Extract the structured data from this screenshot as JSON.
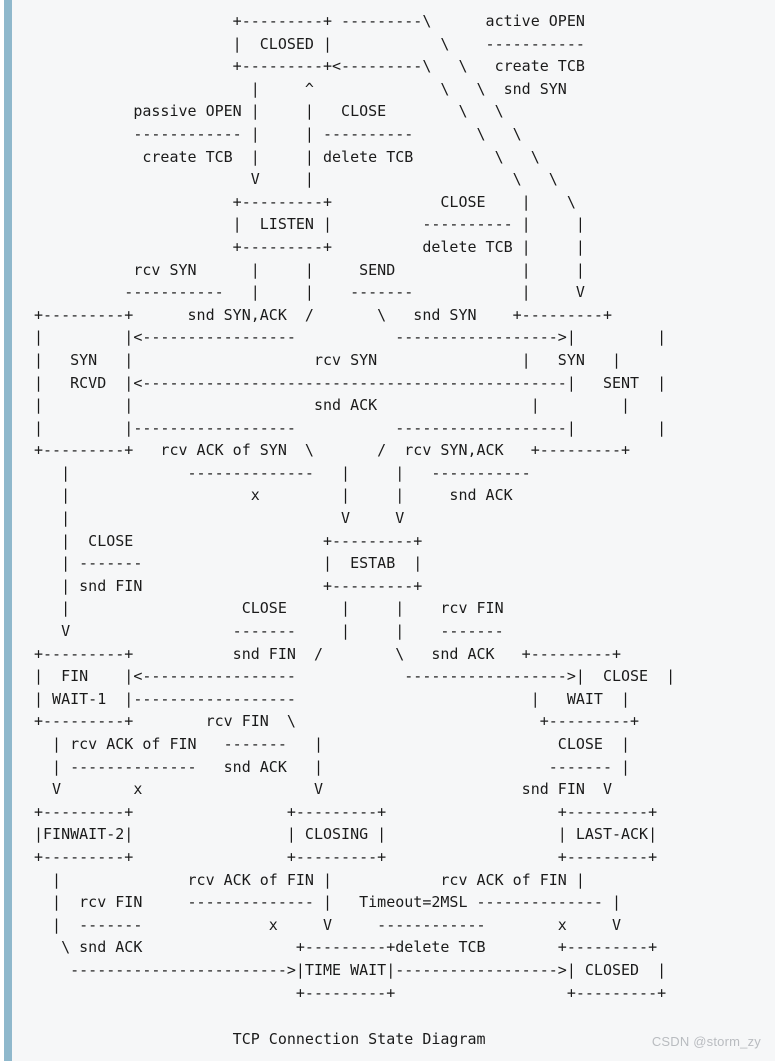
{
  "page": {
    "background_color": "#f6f7f8",
    "page_color": "#ffffff",
    "accent_bar_color": "#8fb8cc",
    "text_color": "#1b1b1b",
    "watermark_color": "#b9bcc0"
  },
  "diagram": {
    "title": "TCP Connection State Diagram",
    "type": "ascii-state-diagram",
    "states": [
      "CLOSED",
      "LISTEN",
      "SYN RCVD",
      "SYN SENT",
      "ESTAB",
      "FIN WAIT-1",
      "CLOSE WAIT",
      "FINWAIT-2",
      "CLOSING",
      "LAST-ACK",
      "TIME WAIT"
    ],
    "events": [
      "active OPEN",
      "passive OPEN",
      "CLOSE",
      "SEND",
      "rcv SYN",
      "rcv ACK of SYN",
      "rcv SYN,ACK",
      "rcv FIN",
      "rcv ACK of FIN",
      "Timeout=2MSL"
    ],
    "actions": [
      "create TCB",
      "snd SYN",
      "delete TCB",
      "snd SYN,ACK",
      "snd ACK",
      "snd FIN",
      "x"
    ],
    "art": "                      +---------+ ---------\\      active OPEN\n                      |  CLOSED |            \\    -----------\n                      +---------+<---------\\   \\   create TCB\n                        |     ^              \\   \\  snd SYN\n           passive OPEN |     |   CLOSE        \\   \\\n           ------------ |     | ----------       \\   \\\n            create TCB  |     | delete TCB         \\   \\\n                        V     |                      \\   \\\n                      +---------+            CLOSE    |    \\\n                      |  LISTEN |          ---------- |     |\n                      +---------+          delete TCB |     |\n           rcv SYN      |     |     SEND              |     |\n          -----------   |     |    -------            |     V\n+---------+      snd SYN,ACK  /       \\   snd SYN    +---------+\n|         |<-----------------           ------------------>|         |\n|   SYN   |                    rcv SYN                |   SYN   |\n|   RCVD  |<-----------------------------------------------|   SENT  |\n|         |                    snd ACK                 |         |\n|         |------------------           -------------------|         |\n+---------+   rcv ACK of SYN  \\       /  rcv SYN,ACK   +---------+\n   |             --------------   |     |   -----------\n   |                    x         |     |     snd ACK\n   |                              V     V\n   |  CLOSE                     +---------+\n   | -------                    |  ESTAB  |\n   | snd FIN                    +---------+\n   |                   CLOSE      |     |    rcv FIN\n   V                  -------     |     |    -------\n+---------+           snd FIN  /        \\   snd ACK   +---------+\n|  FIN    |<-----------------            ------------------>|  CLOSE  |\n| WAIT-1  |------------------                          |   WAIT  |\n+---------+        rcv FIN  \\                           +---------+\n  | rcv ACK of FIN   -------   |                          CLOSE  |\n  | --------------   snd ACK   |                         ------- |\n  V        x                   V                      snd FIN  V\n+---------+                 +---------+                   +---------+\n|FINWAIT-2|                 | CLOSING |                   | LAST-ACK|\n+---------+                 +---------+                   +---------+\n  |              rcv ACK of FIN |            rcv ACK of FIN |\n  |  rcv FIN     -------------- |   Timeout=2MSL -------------- |\n  |  -------              x     V     ------------        x     V\n   \\ snd ACK                 +---------+delete TCB        +---------+\n    ------------------------>|TIME WAIT|------------------>| CLOSED  |\n                             +---------+                   +---------+",
    "lines": [
      "                      +---------+ ---------\\      active OPEN",
      "                      |  CLOSED |            \\    -----------",
      "                      +---------+<---------\\   \\   create TCB",
      "                        |     ^              \\   \\  snd SYN",
      "           passive OPEN |     |   CLOSE        \\   \\",
      "           ------------ |     | ----------       \\   \\",
      "            create TCB  |     | delete TCB         \\   \\",
      "                        V     |                      \\   \\",
      "                      +---------+            CLOSE    |    \\",
      "                      |  LISTEN |          ---------- |     |",
      "                      +---------+          delete TCB |     |",
      "           rcv SYN      |     |     SEND              |     |",
      "          -----------   |     |    -------            |     V",
      "+---------+      snd SYN,ACK  /       \\   snd SYN    +---------+",
      "|         |<-----------------           ------------------>|         |",
      "|   SYN   |                    rcv SYN                |   SYN   |",
      "|   RCVD  |<-----------------------------------------------|   SENT  |",
      "|         |                    snd ACK                 |         |",
      "|         |------------------           -------------------|         |",
      "+---------+   rcv ACK of SYN  \\       /  rcv SYN,ACK   +---------+",
      "   |             --------------   |     |   -----------",
      "   |                    x         |     |     snd ACK",
      "   |                              V     V",
      "   |  CLOSE                     +---------+",
      "   | -------                    |  ESTAB  |",
      "   | snd FIN                    +---------+",
      "   |                   CLOSE      |     |    rcv FIN",
      "   V                  -------     |     |    -------",
      "+---------+           snd FIN  /        \\   snd ACK   +---------+",
      "|  FIN    |<-----------------            ------------------>|  CLOSE  |",
      "| WAIT-1  |------------------                          |   WAIT  |",
      "+---------+        rcv FIN  \\                           +---------+",
      "  | rcv ACK of FIN   -------   |                          CLOSE  |",
      "  | --------------   snd ACK   |                         ------- |",
      "  V        x                   V                      snd FIN  V",
      "+---------+                 +---------+                   +---------+",
      "|FINWAIT-2|                 | CLOSING |                   | LAST-ACK|",
      "+---------+                 +---------+                   +---------+",
      "  |              rcv ACK of FIN |            rcv ACK of FIN |",
      "  |  rcv FIN     -------------- |   Timeout=2MSL -------------- |",
      "  |  -------              x     V     ------------        x     V",
      "   \\ snd ACK                 +---------+delete TCB        +---------+",
      "    ------------------------>|TIME WAIT|------------------>| CLOSED  |",
      "                             +---------+                   +---------+"
    ]
  },
  "caption": {
    "text": "                      TCP Connection State Diagram"
  },
  "watermark": {
    "text": "CSDN @storm_zy"
  }
}
